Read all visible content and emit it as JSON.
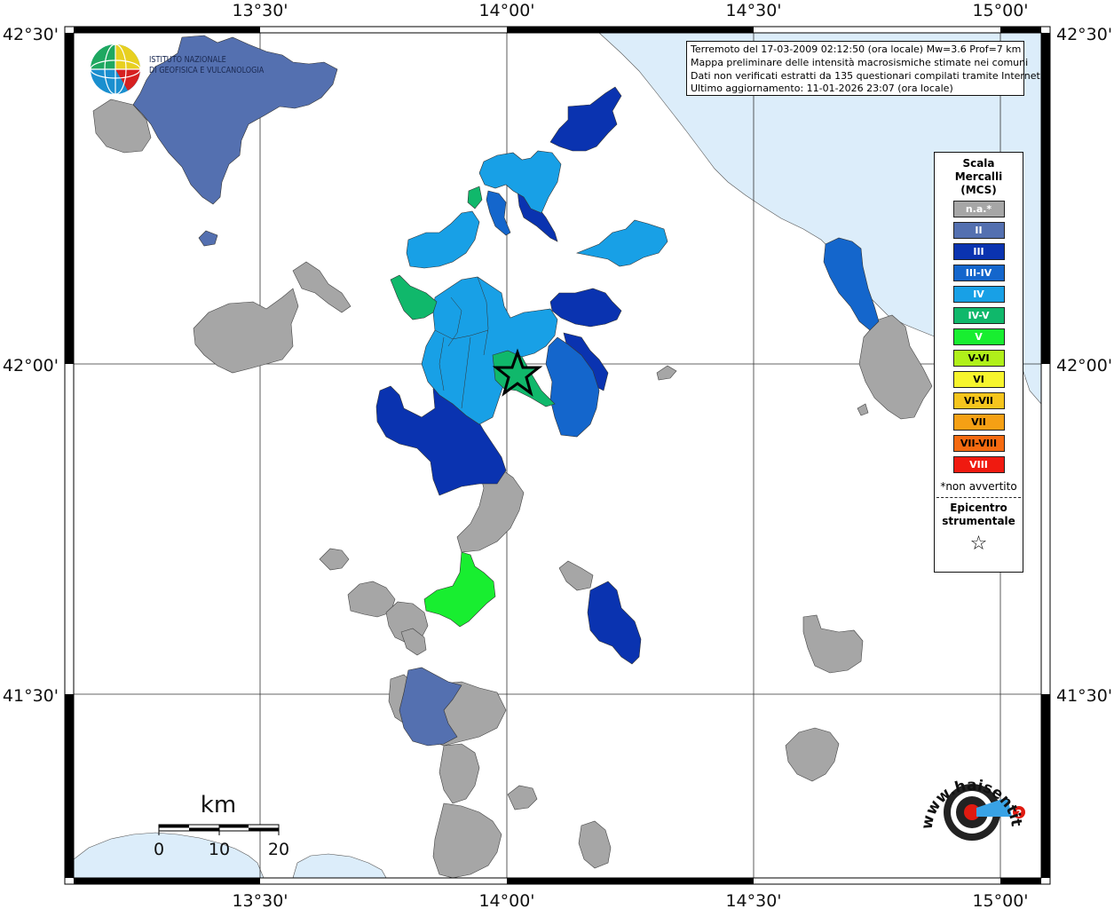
{
  "info": {
    "line1": "Terremoto del 17-03-2009 02:12:50 (ora locale) Mw=3.6 Prof=7 km",
    "line2": "Mappa preliminare delle intensità macrosismiche stimate nei comuni",
    "line3": "Dati non verificati estratti da 135 questionari compilati tramite Internet.",
    "line4": "Ultimo aggiornamento: 11-01-2026 23:07 (ora locale)"
  },
  "coords": {
    "top": [
      "13°30'",
      "14°00'",
      "14°30'",
      "15°00'"
    ],
    "bottom": [
      "13°30'",
      "14°00'",
      "14°30'",
      "15°00'"
    ],
    "left": [
      "42°30'",
      "42°00'",
      "41°30'"
    ],
    "right": [
      "42°30'",
      "42°00'",
      "41°30'"
    ]
  },
  "legend": {
    "title": "Scala\nMercalli\n(MCS)",
    "items": [
      {
        "label": "n.a.*",
        "color": "#a6a6a6"
      },
      {
        "label": "II",
        "color": "#5470b0"
      },
      {
        "label": "III",
        "color": "#0a33b0"
      },
      {
        "label": "III-IV",
        "color": "#1466cc"
      },
      {
        "label": "IV",
        "color": "#18a0e6"
      },
      {
        "label": "IV-V",
        "color": "#10b86b"
      },
      {
        "label": "V",
        "color": "#18ee30"
      },
      {
        "label": "V-VI",
        "color": "#b0f01a"
      },
      {
        "label": "VI",
        "color": "#f7f52d"
      },
      {
        "label": "VI-VII",
        "color": "#f5c51d"
      },
      {
        "label": "VII",
        "color": "#f5a014"
      },
      {
        "label": "VII-VIII",
        "color": "#f56a10"
      },
      {
        "label": "VIII",
        "color": "#f01a10"
      }
    ],
    "note": "*non avvertito",
    "epicenter_title": "Epicentro\nstrumentale",
    "epicenter_symbol": "☆"
  },
  "ingv": {
    "line1": "ISTITUTO NAZIONALE",
    "line2": "DI GEOFISICA E VULCANOLOGIA"
  },
  "scalebar": {
    "unit": "km",
    "ticks": [
      "0",
      "10",
      "20"
    ]
  },
  "hsit": {
    "brand": "www.haisentitoilterremoto.it"
  },
  "colors": {
    "sea": "#dcedfa",
    "na": "#a6a6a6",
    "II": "#5470b0",
    "III": "#0a33b0",
    "III-IV": "#1466cc",
    "IV": "#18a0e6",
    "IV-V": "#10b86b",
    "V": "#18ee30"
  }
}
